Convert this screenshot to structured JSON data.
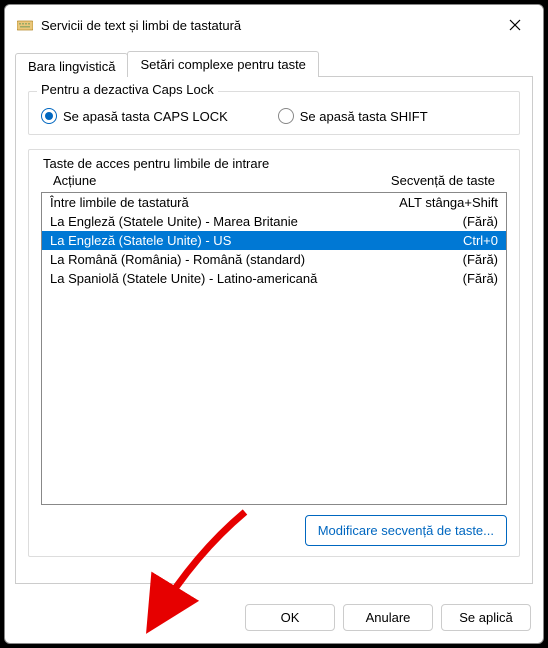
{
  "window": {
    "title": "Servicii de text și limbi de tastatură"
  },
  "tabs": {
    "language_bar": "Bara lingvistică",
    "advanced": "Setări complexe pentru taste"
  },
  "caps_group": {
    "legend": "Pentru a dezactiva Caps Lock",
    "opt_caps": "Se apasă tasta CAPS LOCK",
    "opt_shift": "Se apasă tasta SHIFT"
  },
  "hotkeys_group": {
    "legend": "Taste de acces pentru limbile de intrare",
    "col_action": "Acțiune",
    "col_keys": "Secvență de taste",
    "rows": [
      {
        "action": "Între limbile de tastatură",
        "keys": "ALT stânga+Shift"
      },
      {
        "action": "La Engleză (Statele Unite) - Marea Britanie",
        "keys": "(Fără)"
      },
      {
        "action": "La Engleză (Statele Unite) - US",
        "keys": "Ctrl+0"
      },
      {
        "action": "La Română (România) - Română (standard)",
        "keys": "(Fără)"
      },
      {
        "action": "La Spaniolă (Statele Unite) - Latino-americană",
        "keys": "(Fără)"
      }
    ],
    "change_button": "Modificare secvență de taste..."
  },
  "footer": {
    "ok": "OK",
    "cancel": "Anulare",
    "apply": "Se aplică"
  }
}
